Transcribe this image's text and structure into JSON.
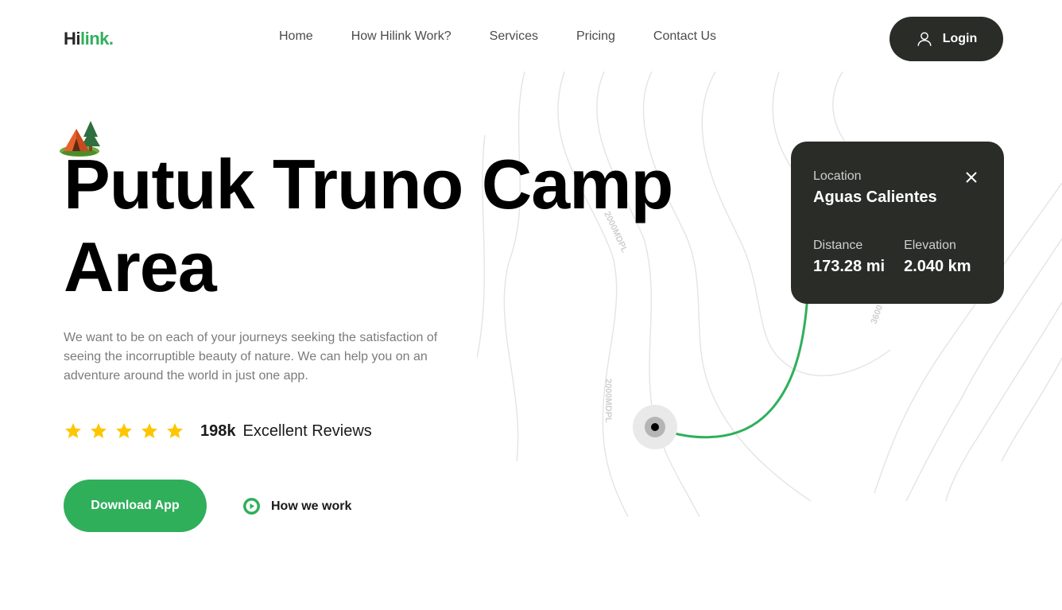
{
  "header": {
    "logo_part1": "Hi",
    "logo_part2": "link.",
    "nav": [
      "Home",
      "How Hilink Work?",
      "Services",
      "Pricing",
      "Contact Us"
    ],
    "login_label": "Login"
  },
  "hero": {
    "icon": "camp-tent-icon",
    "title_line1": "Putuk Truno Camp",
    "title_line2": "Area",
    "description": "We want to be on each of your journeys seeking the satisfaction of seeing the incorruptible beauty of nature. We can help you on an adventure around the world in just one app.",
    "stars": 5,
    "review_count": "198k",
    "review_label": "Excellent Reviews",
    "download_label": "Download App",
    "how_label": "How we work"
  },
  "map": {
    "contour_labels": [
      "2000MDPL",
      "2000MDPL",
      "3600"
    ],
    "route_color": "#30af5b"
  },
  "location_card": {
    "location_label": "Location",
    "location_value": "Aguas Calientes",
    "distance_label": "Distance",
    "distance_value": "173.28 mi",
    "elevation_label": "Elevation",
    "elevation_value": "2.040 km"
  },
  "colors": {
    "accent": "#30af5b",
    "dark": "#292c27",
    "star": "#fec601"
  }
}
